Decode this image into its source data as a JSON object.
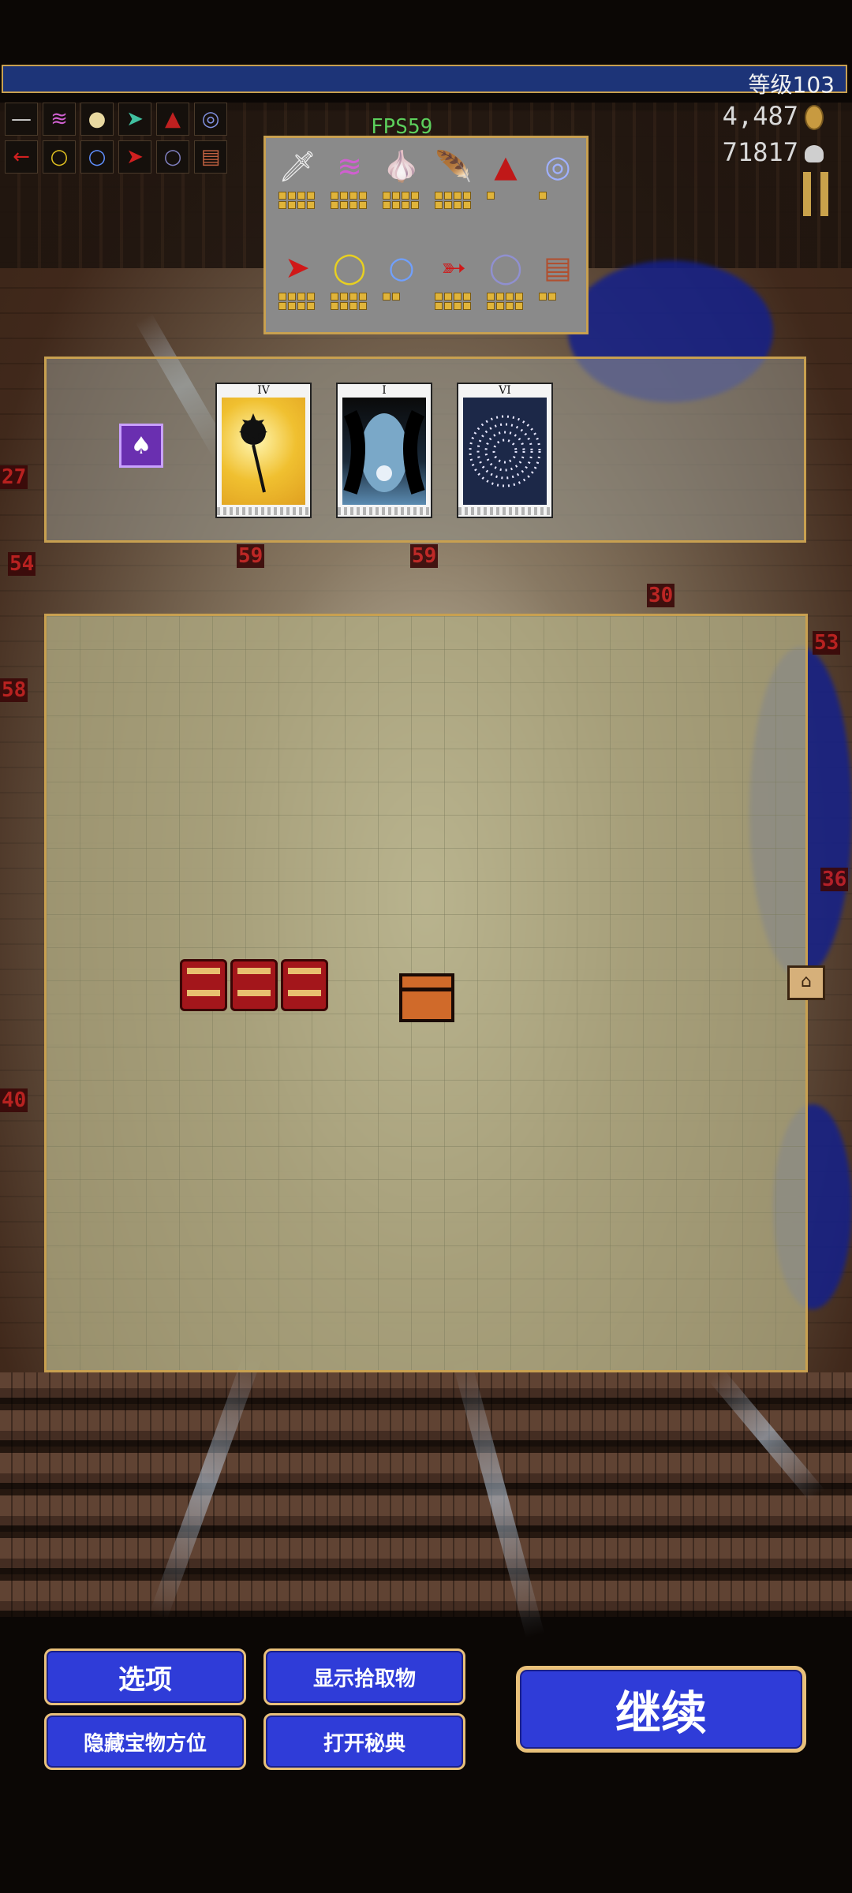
{
  "hud": {
    "level_label": "等级103",
    "fps_label": "FPS59",
    "gold": "4,487",
    "kills": "71817"
  },
  "weapon_bar": {
    "row1": [
      "knife-icon",
      "claw-icon",
      "garlic-icon",
      "wing-icon",
      "red-cloak-icon",
      "orb-icon"
    ],
    "row2": [
      "red-arrow-icon",
      "gold-ring-icon",
      "blue-ring-icon",
      "red-spear-icon",
      "silver-ring-icon",
      "cake-icon"
    ]
  },
  "items_panel": {
    "row1": [
      {
        "name": "knife-icon",
        "glyph": "🗡",
        "levels": 8
      },
      {
        "name": "claw-icon",
        "glyph": "≋",
        "levels": 8
      },
      {
        "name": "garlic-icon",
        "glyph": "🧄",
        "levels": 8
      },
      {
        "name": "wing-icon",
        "glyph": "🪶",
        "levels": 8
      },
      {
        "name": "red-cloak-icon",
        "glyph": "▲",
        "levels": 1
      },
      {
        "name": "orb-icon",
        "glyph": "◎",
        "levels": 1
      }
    ],
    "row2": [
      {
        "name": "red-arrow-icon",
        "glyph": "➤",
        "levels": 8
      },
      {
        "name": "gold-ring-icon",
        "glyph": "◯",
        "levels": 8
      },
      {
        "name": "blue-ring-icon",
        "glyph": "○",
        "levels": 2
      },
      {
        "name": "red-spear-icon",
        "glyph": "➳",
        "levels": 8
      },
      {
        "name": "silver-ring-icon",
        "glyph": "◯",
        "levels": 8
      },
      {
        "name": "cake-icon",
        "glyph": "▤",
        "levels": 2
      }
    ]
  },
  "arcana": {
    "cards": [
      {
        "numeral": "IV"
      },
      {
        "numeral": "I"
      },
      {
        "numeral": "VI"
      }
    ]
  },
  "buttons": {
    "options": "选项",
    "show_pickups": "显示拾取物",
    "hide_treasure": "隐藏宝物方位",
    "open_grimoire": "打开秘典",
    "continue": "继续"
  },
  "colors": {
    "xp_bar": "#1d3478",
    "border_gold": "#c8a050",
    "button_blue": "#2f3cd8"
  }
}
